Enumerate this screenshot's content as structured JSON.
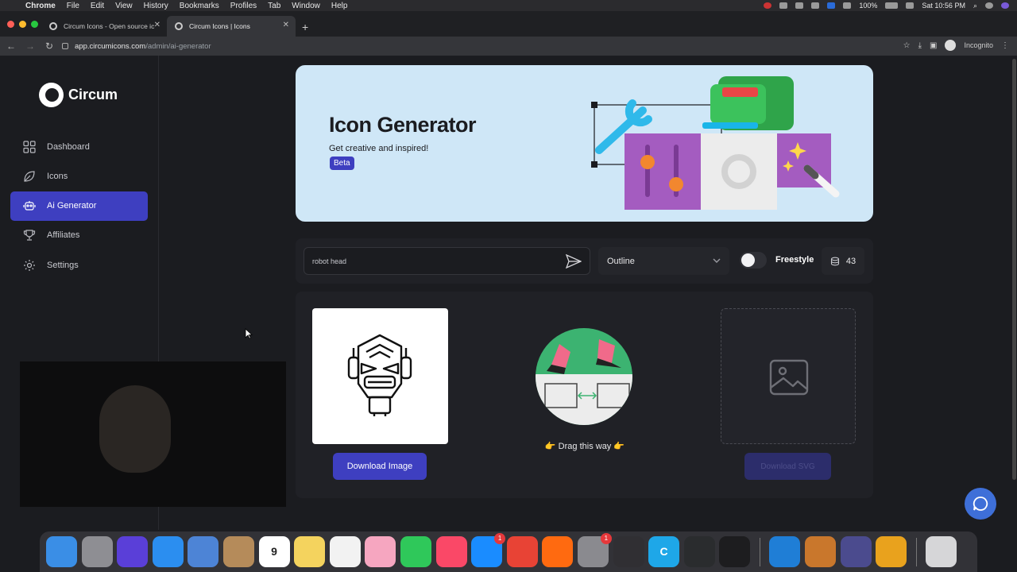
{
  "menubar": {
    "app": "Chrome",
    "items": [
      "File",
      "Edit",
      "View",
      "History",
      "Bookmarks",
      "Profiles",
      "Tab",
      "Window",
      "Help"
    ],
    "battery": "100%",
    "clock": "Sat 10:56 PM"
  },
  "browser": {
    "tabs": [
      {
        "title": "Circum Icons - Open source ic"
      },
      {
        "title": "Circum Icons | Icons"
      }
    ],
    "url_host": "app.circumicons.com",
    "url_path": "/admin/ai-generator",
    "profile": "Incognito"
  },
  "sidebar": {
    "brand": "Circum",
    "items": [
      {
        "label": "Dashboard",
        "icon": "grid-icon",
        "active": false
      },
      {
        "label": "Icons",
        "icon": "leaf-icon",
        "active": false
      },
      {
        "label": "Ai Generator",
        "icon": "robot-icon",
        "active": true
      },
      {
        "label": "Affiliates",
        "icon": "trophy-icon",
        "active": false
      },
      {
        "label": "Settings",
        "icon": "gear-icon",
        "active": false
      }
    ]
  },
  "banner": {
    "title": "Icon Generator",
    "subtitle": "Get creative and inspired!",
    "badge": "Beta",
    "colors": {
      "background": "#cfe7f7",
      "accent": "#3e3fc0"
    }
  },
  "generator": {
    "prompt_value": "robot head",
    "style_value": "Outline",
    "freestyle_label": "Freestyle",
    "freestyle_on": false,
    "credits": "43"
  },
  "results": {
    "download_image_label": "Download Image",
    "drag_hint": "👉 Drag this way 👉",
    "download_svg_label": "Download SVG"
  },
  "dock": {
    "apps": [
      {
        "name": "finder-icon",
        "color": "#3a8ee6"
      },
      {
        "name": "launchpad-icon",
        "color": "#8e8e93"
      },
      {
        "name": "siri-icon",
        "color": "#5a3fd8"
      },
      {
        "name": "safari-icon",
        "color": "#2b8ef0"
      },
      {
        "name": "mail-icon",
        "color": "#4d84d6"
      },
      {
        "name": "contacts-icon",
        "color": "#b58b5a"
      },
      {
        "name": "calendar-icon",
        "color": "#ffffff",
        "text": "9"
      },
      {
        "name": "notes-icon",
        "color": "#f4d35e"
      },
      {
        "name": "reminders-icon",
        "color": "#f2f2f2"
      },
      {
        "name": "photos-icon",
        "color": "#f6a6c0"
      },
      {
        "name": "facetime-icon",
        "color": "#2fc85a"
      },
      {
        "name": "music-icon",
        "color": "#fa4867"
      },
      {
        "name": "app-store-icon",
        "color": "#1a8cff",
        "badge": "1"
      },
      {
        "name": "chrome-icon",
        "color": "#e84335"
      },
      {
        "name": "soundcloud-icon",
        "color": "#ff6a10"
      },
      {
        "name": "system-preferences-icon",
        "color": "#8a8a8f",
        "badge": "1"
      },
      {
        "name": "obs-icon",
        "color": "#302f33"
      },
      {
        "name": "circum-icon",
        "color": "#1ea7e8",
        "text": "C"
      },
      {
        "name": "activity-monitor-icon",
        "color": "#2a2c2e"
      },
      {
        "name": "terminal-icon",
        "color": "#1d1d1f"
      },
      {
        "name": "vscode-icon",
        "color": "#1f7ed6"
      },
      {
        "name": "calculator-icon",
        "color": "#c9772c"
      },
      {
        "name": "quicktime-icon",
        "color": "#4b4b8e"
      },
      {
        "name": "audacity-icon",
        "color": "#e9a21d"
      },
      {
        "name": "trash-icon",
        "color": "#d6d6d8"
      }
    ]
  }
}
